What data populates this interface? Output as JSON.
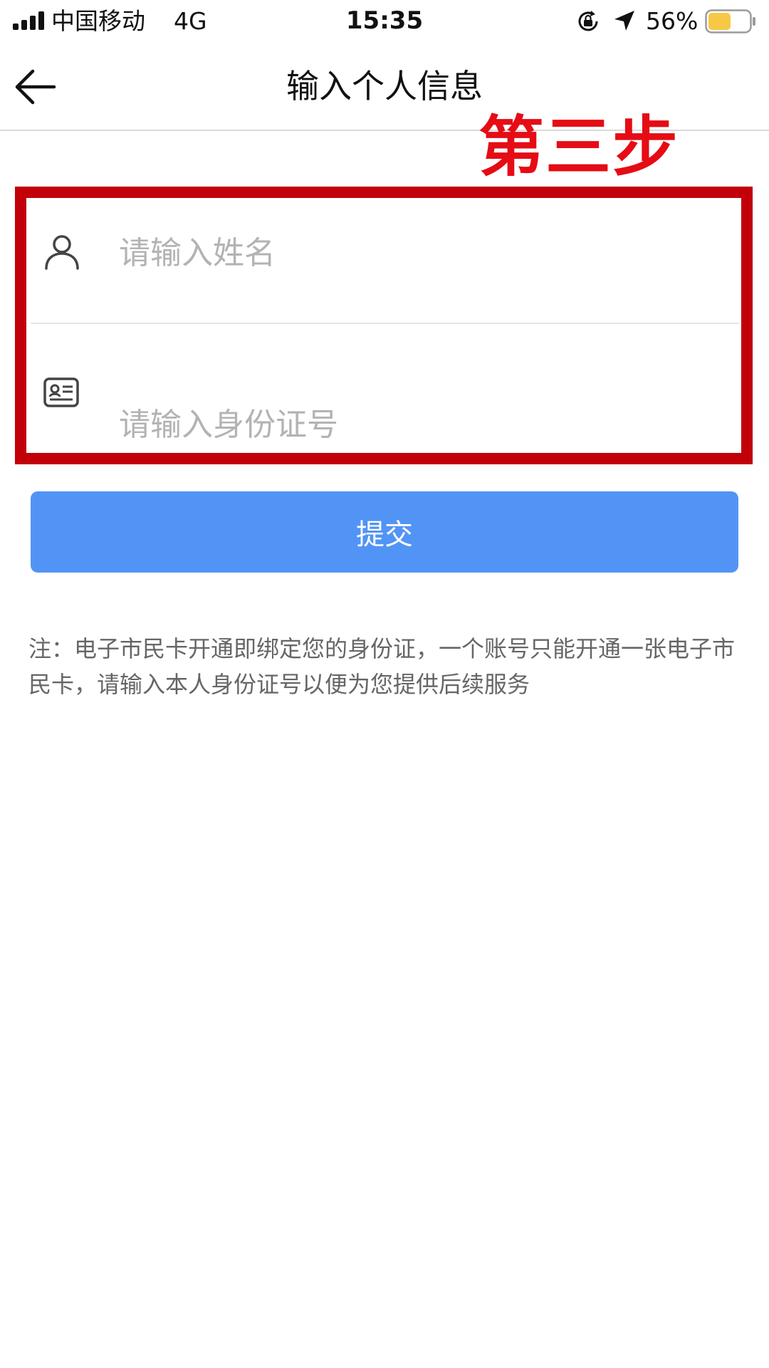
{
  "status_bar": {
    "carrier": "中国移动",
    "network": "4G",
    "time": "15:35",
    "battery_percent": "56%",
    "battery_level": 0.56,
    "battery_color": "#f6c845"
  },
  "nav": {
    "back_icon": "arrow-left-icon",
    "title": "输入个人信息"
  },
  "annotation": {
    "step_label": "第三步",
    "color": "#e50c15",
    "box_color": "#c10009"
  },
  "form": {
    "name": {
      "icon": "user-icon",
      "value": "",
      "placeholder": "请输入姓名"
    },
    "id_number": {
      "icon": "id-card-icon",
      "value": "",
      "placeholder": "请输入身份证号"
    }
  },
  "submit": {
    "label": "提交",
    "color": "#5294f5"
  },
  "note": "注：电子市民卡开通即绑定您的身份证，一个账号只能开通一张电子市民卡，请输入本人身份证号以便为您提供后续服务"
}
